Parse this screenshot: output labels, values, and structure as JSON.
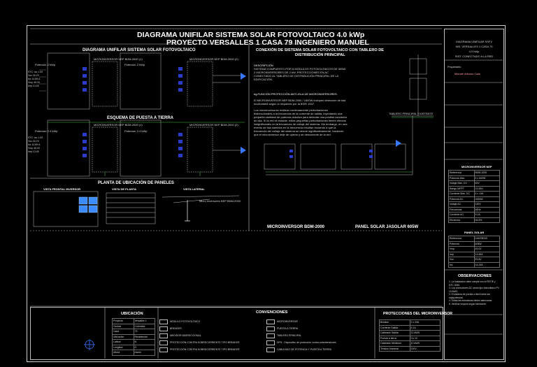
{
  "header": {
    "title_line1": "DIAGRAMA UNIFILAR SISTEMA SOLAR FOTOVOLTAICO 4.0 kWp",
    "title_line2": "PROYECTO VERSALLES 1 CASA 79 INGENIERO MANUEL"
  },
  "sections": {
    "unifilar": "DIAGRAMA UNIFILAR SISTEMA SOLAR FOTOVOLTAICO",
    "tierra": "ESQUEMA DE PUESTA A TIERRA",
    "planta": "PLANTA DE UBICACIÓN DE PANELES",
    "conexion_l1": "CONEXIÓN DE SISTEMA SOLAR FOTOVOLTAICO CON TABLERO DE",
    "conexion_l2": "DISTRIBUCIÓN PRINCIPAL",
    "microinversor": "MICROINVERSOR BDM-2000",
    "panel": "PANEL SOLAR JASOLAR 605W",
    "ubicacion": "UBICACIÓN",
    "convenciones": "CONVENCIONES",
    "protecciones": "PROTECCIONES DEL MICROINVERSOR",
    "observaciones": "OBSERVACIONES"
  },
  "unifilar_labels": {
    "potencia_a": "Potencia: 2 kWp",
    "potencia_b": "Potencia: 2 kWp",
    "micro_a": "MICROINVERSOR NEP BDM-2000 (1)",
    "micro_b": "MICROINVERSOR NEP BDM-2000 (2)",
    "potencia_c": "Potencia: 2.4 kWp",
    "potencia_d": "Potencia: 2.4 kWp",
    "micro_c": "MICROINVERSOR NEP BDM-2000 (1)",
    "micro_d": "MICROINVERSOR NEP BDM-2000 (2)"
  },
  "planta_labels": {
    "vista_frontal": "VISTA FRONTAL INVERSOR",
    "vista_planta": "VISTA DE PLANTA",
    "vista_lateral": "VISTA LATERAL",
    "micro_note": "Micro Inversores NEP BDM-2000"
  },
  "descripcion": {
    "heading": "DESCRIPCIÓN",
    "lines": [
      "SISTEMA COMPUESTO POR 8 MÓDULOS FOTOVOLTAICOS DE 505W",
      "2 MICROINVERSORES DE 2 kW, PROTECCIONES EN AC",
      "CONECTADO AL TABLERO DE DISTRIBUCIÓN PRINCIPAL DE LA",
      "EDIFICACIÓN."
    ],
    "antiisla_heading": "eg.FUNCIÓN PROTECCIÓN ANTI-ISLA DE MICROINVERSORES.",
    "antiisla_lines": [
      "El MICROINVERSOR NEP BDM-2000 / 1500W incluyen detección de isla",
      "involuntaria según lo requerido por la IEEE 1547."
    ],
    "body_lines": [
      "Los microinversores realizan continuamente perturbaciones",
      "bidireccionales a la frecuencia de la corriente de salida, inyectando una",
      "pequeña cantidad de potencia reactiva para detectar una posible condición",
      "de isla. Si la red es estable, estas pequeñas perturbaciones tienen efectos",
      "insignificantes en la frecuencia de voltaje del sistema. Sin embargo, en una",
      "evento de isla cambios en la frecuencia resultan forzando a que la",
      "frecuencia del voltaje del sistema se desvíe significativamente, haciendo",
      "que el microinversor deje de operar y se desconecte de la red."
    ]
  },
  "tablero_label": "TABLERO PRINCIPAL EXISTENTE",
  "title_block": {
    "project_box": [
      "DIAGRAMA UNIFILAR SSFV",
      "INS. VERSALLES 1 CASA 79",
      "4.0 kWp",
      "SIST. CONECTADO A LA RED"
    ],
    "propietario_label": "Propietario",
    "propietario": "Manuel Alfonso Cala",
    "microinversor_table_title": "MICROINVERSOR NEP",
    "microinversor_rows": [
      [
        "Referencia",
        "BDM-2000"
      ],
      [
        "Potencia Max. Entrada",
        "4 x 600W"
      ],
      [
        "Voltaje Max. DC",
        "60V"
      ],
      [
        "Rango MPPT",
        "22-55V"
      ],
      [
        "Corriente Max. DC",
        "4 x 13A"
      ],
      [
        "Potencia AC",
        "2000W"
      ],
      [
        "Voltaje AC",
        "220V"
      ],
      [
        "Frecuencia",
        "60Hz"
      ],
      [
        "Corriente AC",
        "9.1A"
      ],
      [
        "Eficiencia",
        "96.5%"
      ]
    ],
    "panel_table_title": "PANEL SOLAR",
    "panel_rows": [
      [
        "Referencia",
        "JAM78D30"
      ],
      [
        "Potencia",
        "605W"
      ],
      [
        "Vmp",
        "45.0V"
      ],
      [
        "Imp",
        "13.45A"
      ],
      [
        "Voc",
        "53.5V"
      ],
      [
        "Isc",
        "14.24A"
      ]
    ],
    "obs_lines": [
      "1. La instalación debe cumplir con el RETIE y NTC 2050.",
      "2. Los conductores DC serán tipo fotovoltaico PV 10 AWG.",
      "3. El sistema de puesta a tierra debe ser equipotencial.",
      "4. Todas las estructuras deben aterrizarse.",
      "5. Verificar torques según fabricante."
    ]
  },
  "ubicacion_rows": [
    [
      "Proyecto",
      "Versalles 1"
    ],
    [
      "Ciudad",
      "Colombia"
    ],
    [
      "Casa",
      "79"
    ],
    [
      "Ubicación",
      "Residencial"
    ],
    [
      "Latitud",
      "N"
    ],
    [
      "Longitud",
      "O"
    ],
    [
      "Altura",
      "msnm"
    ]
  ],
  "convenciones_items": [
    "MÓDULO FOTOVOLTAICO",
    "MICROINVERSOR",
    "BREAKER",
    "PUESTA A TIERRA",
    "MEDIDOR BIDIRECCIONAL",
    "TABLERO PRINCIPAL",
    "PROTECCIÓN CONTRA SOBRECORRIENTE TIPO BREAKER",
    "DPS - Dispositivo de protección contra sobretensiones",
    "PROTECCIÓN CONTRA SOBRECORRIENTE TIPO BREAKER",
    "CABLEADO DE POTENCIA Y PUESTA A TIERRA"
  ],
  "protecciones_rows": [
    [
      "Breaker",
      "2 x 20A"
    ],
    [
      "Corriente Salida",
      "9.1A"
    ],
    [
      "Cableado Salida",
      "12 AWG"
    ],
    [
      "Puesta a tierra",
      "Cu 10"
    ],
    [
      "Cableado Medición",
      "10 AWG"
    ],
    [
      "Tensión Nominal",
      "220V"
    ]
  ]
}
